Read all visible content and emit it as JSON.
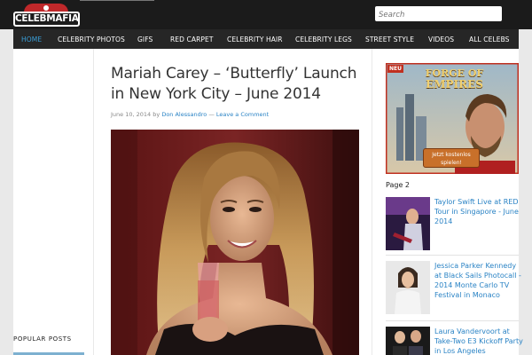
{
  "header": {
    "logo_text": "CELEBMAFIA",
    "search_placeholder": "Search"
  },
  "nav": {
    "items": [
      {
        "label": "HOME",
        "active": true
      },
      {
        "label": "CELEBRITY PHOTOS"
      },
      {
        "label": "GIFS"
      },
      {
        "label": "RED CARPET"
      },
      {
        "label": "CELEBRITY HAIR"
      },
      {
        "label": "CELEBRITY LEGS"
      },
      {
        "label": "STREET STYLE"
      },
      {
        "label": "VIDEOS"
      },
      {
        "label": "ALL CELEBS"
      }
    ]
  },
  "left_sidebar": {
    "popular_posts_heading": "POPULAR POSTS"
  },
  "post": {
    "title": "Mariah Carey – ‘Butterfly’ Launch in New York City – June 2014",
    "date": "June 10, 2014",
    "by": "by",
    "author": "Don Alessandro",
    "separator": "—",
    "comment_link": "Leave a Comment"
  },
  "ad": {
    "badge": "NEU",
    "game_title_line1": "FORGE OF",
    "game_title_line2": "EMPIRES",
    "cta_line1": "Jetzt kostenlos",
    "cta_line2": "spielen!"
  },
  "right_sidebar": {
    "page_label": "Page 2",
    "items": [
      {
        "caption": "Taylor Swift Live at RED Tour in Singapore - June 2014"
      },
      {
        "caption": "Jessica Parker Kennedy at Black Sails Photocall - 2014 Monte Carlo TV Festival in Monaco"
      },
      {
        "caption": "Laura Vandervoort at Take-Two E3 Kickoff Party in Los Angeles"
      }
    ]
  },
  "colors": {
    "accent": "#2a83c5",
    "nav_active": "#3a9fd8",
    "header_bg": "#1b1b1b",
    "nav_bg": "#262626",
    "logo_red": "#c0282a"
  }
}
